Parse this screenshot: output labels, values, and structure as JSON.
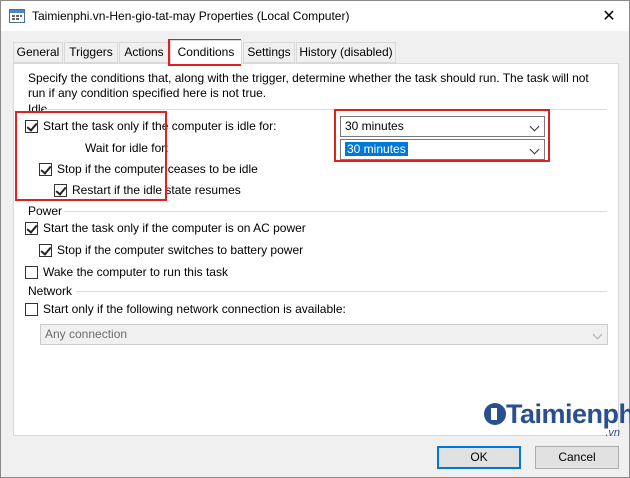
{
  "window": {
    "title": "Taimienphi.vn-Hen-gio-tat-may Properties (Local Computer)",
    "close_glyph": "✕"
  },
  "tabs": [
    {
      "label": "General"
    },
    {
      "label": "Triggers"
    },
    {
      "label": "Actions"
    },
    {
      "label": "Conditions",
      "active": true
    },
    {
      "label": "Settings"
    },
    {
      "label": "History (disabled)"
    }
  ],
  "conditions": {
    "description": "Specify the conditions that, along with the trigger, determine whether the task should run.  The task will not run  if any condition specified here is not true.",
    "idle": {
      "section_label": "Idle",
      "start_only_if_idle": {
        "label": "Start the task only if the computer is idle for:",
        "checked": true
      },
      "idle_duration": "30 minutes",
      "wait_for_idle_label": "Wait for idle for:",
      "wait_duration": "30 minutes",
      "stop_if_not_idle": {
        "label": "Stop if the computer ceases to be idle",
        "checked": true
      },
      "restart_if_idle": {
        "label": "Restart if the idle state resumes",
        "checked": true
      }
    },
    "power": {
      "section_label": "Power",
      "ac_power_only": {
        "label": "Start the task only if the computer is on AC power",
        "checked": true
      },
      "stop_on_battery": {
        "label": "Stop if the computer switches to battery power",
        "checked": true
      },
      "wake_to_run": {
        "label": "Wake the computer to run this task",
        "checked": false
      }
    },
    "network": {
      "section_label": "Network",
      "network_only": {
        "label": "Start only if the following network connection is available:",
        "checked": false
      },
      "connection": "Any connection"
    }
  },
  "buttons": {
    "ok": "OK",
    "cancel": "Cancel"
  },
  "watermark": {
    "name": "Taimienphi",
    "domain": ".vn",
    "brand_color": "#2a4f8e"
  },
  "colors": {
    "highlight_box": "#e02020",
    "selection": "#0078d7"
  }
}
